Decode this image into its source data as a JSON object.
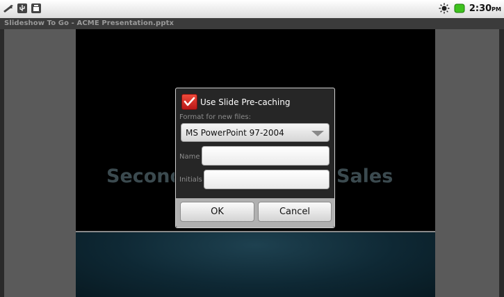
{
  "status_bar": {
    "time": "2:30",
    "ampm": "PM",
    "left_icons": [
      "wrench-icon",
      "usb-icon",
      "sd-card-icon"
    ],
    "right_icons": [
      "brightness-icon",
      "battery-icon"
    ]
  },
  "app": {
    "title": "Slideshow To Go - ACME Presentation.pptx"
  },
  "slide": {
    "text_left": "Second",
    "text_right": "Sales"
  },
  "dialog": {
    "checkbox_label": "Use Slide Pre-caching",
    "checkbox_checked": true,
    "format_label": "Format for new files:",
    "format_value": "MS PowerPoint 97-2004",
    "name_label": "Name",
    "name_value": "",
    "initials_label": "Initials",
    "initials_value": "",
    "ok_label": "OK",
    "cancel_label": "Cancel"
  },
  "colors": {
    "checkbox_red": "#d8291e",
    "side_panel": "#5a5a5a",
    "dialog_bg": "#262626"
  }
}
